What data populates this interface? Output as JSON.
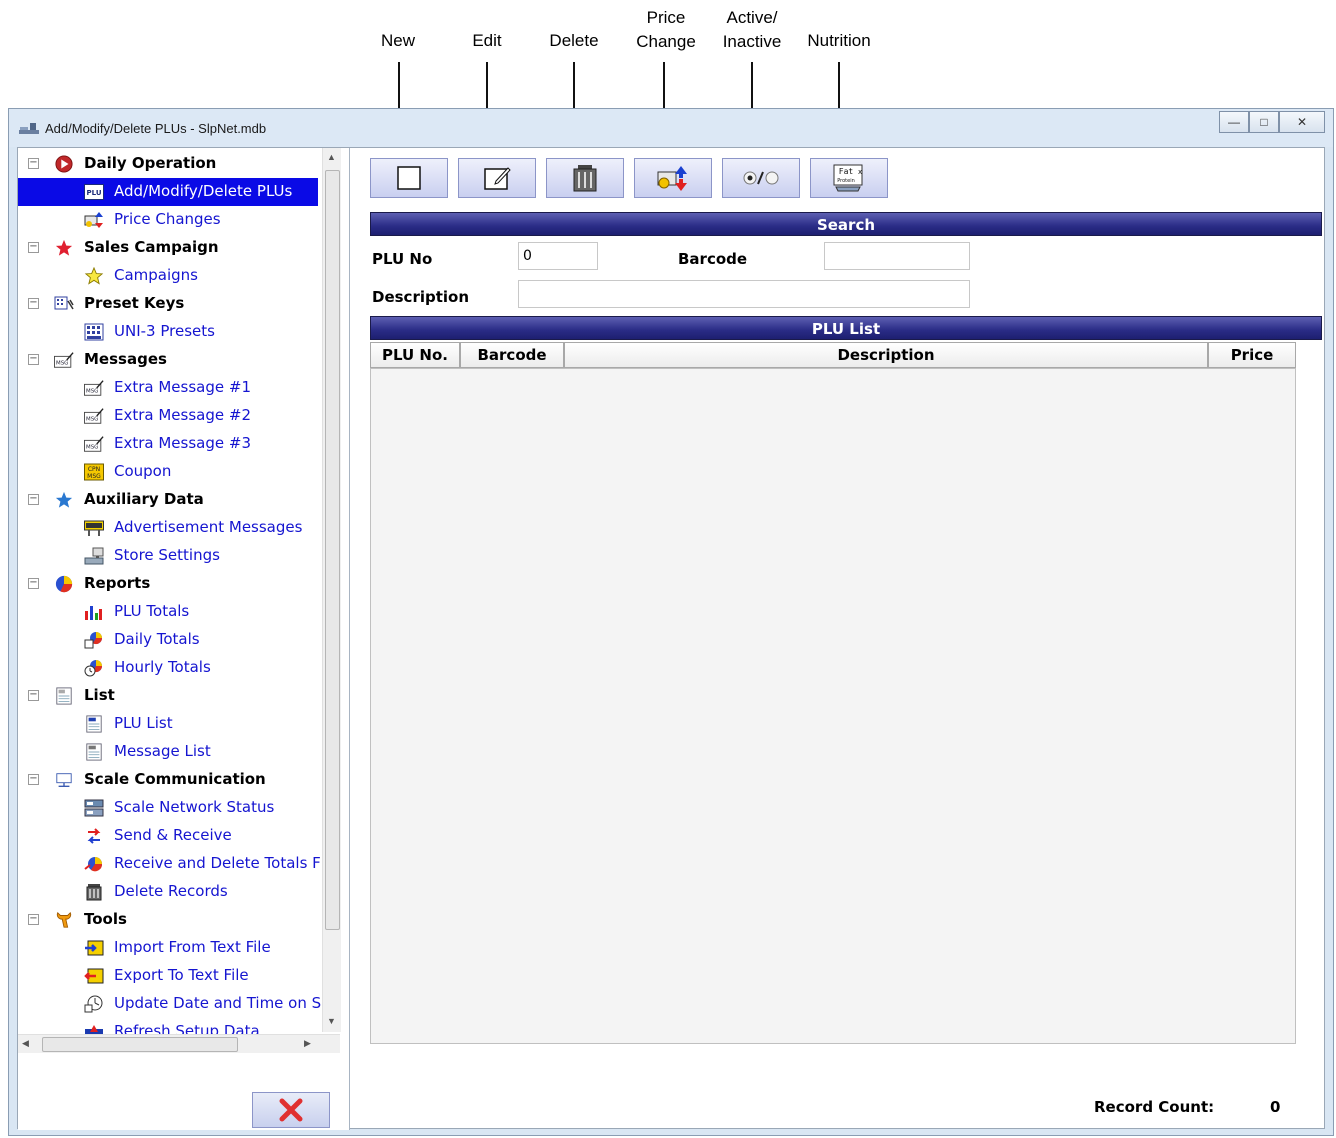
{
  "callouts": {
    "new": "New",
    "edit": "Edit",
    "delete": "Delete",
    "price_change_1": "Price",
    "price_change_2": "Change",
    "active_1": "Active/",
    "active_2": "Inactive",
    "nutrition": "Nutrition"
  },
  "window": {
    "title": "Add/Modify/Delete PLUs - SlpNet.mdb",
    "minimize": "—",
    "maximize": "□",
    "close": "✕"
  },
  "tree": {
    "expander": "−",
    "categories": [
      {
        "label": "Daily Operation",
        "icon": "play-icon"
      },
      {
        "label": "Sales Campaign",
        "icon": "star-icon"
      },
      {
        "label": "Preset Keys",
        "icon": "preset-keys-icon"
      },
      {
        "label": "Messages",
        "icon": "message-icon"
      },
      {
        "label": "Auxiliary Data",
        "icon": "blue-star-icon"
      },
      {
        "label": "Reports",
        "icon": "pie-chart-icon"
      },
      {
        "label": "List",
        "icon": "list-icon"
      },
      {
        "label": "Scale Communication",
        "icon": "network-icon"
      },
      {
        "label": "Tools",
        "icon": "wrench-icon"
      }
    ],
    "items": {
      "daily_operation": [
        "Add/Modify/Delete PLUs",
        "Price Changes"
      ],
      "sales_campaign": [
        "Campaigns"
      ],
      "preset_keys": [
        "UNI-3 Presets"
      ],
      "messages": [
        "Extra Message #1",
        "Extra Message #2",
        "Extra Message #3",
        "Coupon"
      ],
      "auxiliary_data": [
        "Advertisement Messages",
        "Store Settings"
      ],
      "reports": [
        "PLU Totals",
        "Daily Totals",
        "Hourly Totals"
      ],
      "list": [
        "PLU List",
        "Message List"
      ],
      "scale_communication": [
        "Scale Network Status",
        "Send & Receive",
        "Receive and Delete Totals F",
        "Delete Records"
      ],
      "tools": [
        "Import From Text File",
        "Export To Text File",
        "Update Date and Time on S",
        "Refresh Setup Data"
      ]
    },
    "selected": "Add/Modify/Delete PLUs"
  },
  "search": {
    "title": "Search",
    "plu_no_label": "PLU No",
    "plu_no_value": "0",
    "barcode_label": "Barcode",
    "barcode_value": "",
    "description_label": "Description",
    "description_value": ""
  },
  "plu_list": {
    "title": "PLU List",
    "columns": [
      "PLU No.",
      "Barcode",
      "Description",
      "Price"
    ],
    "rows": []
  },
  "footer": {
    "record_count_label": "Record Count:",
    "record_count_value": "0"
  },
  "colors": {
    "section_bar": "#2a2c86",
    "selected_item": "#0a0ae6",
    "link_text": "#1515d0",
    "exit_x": "#e03030"
  }
}
